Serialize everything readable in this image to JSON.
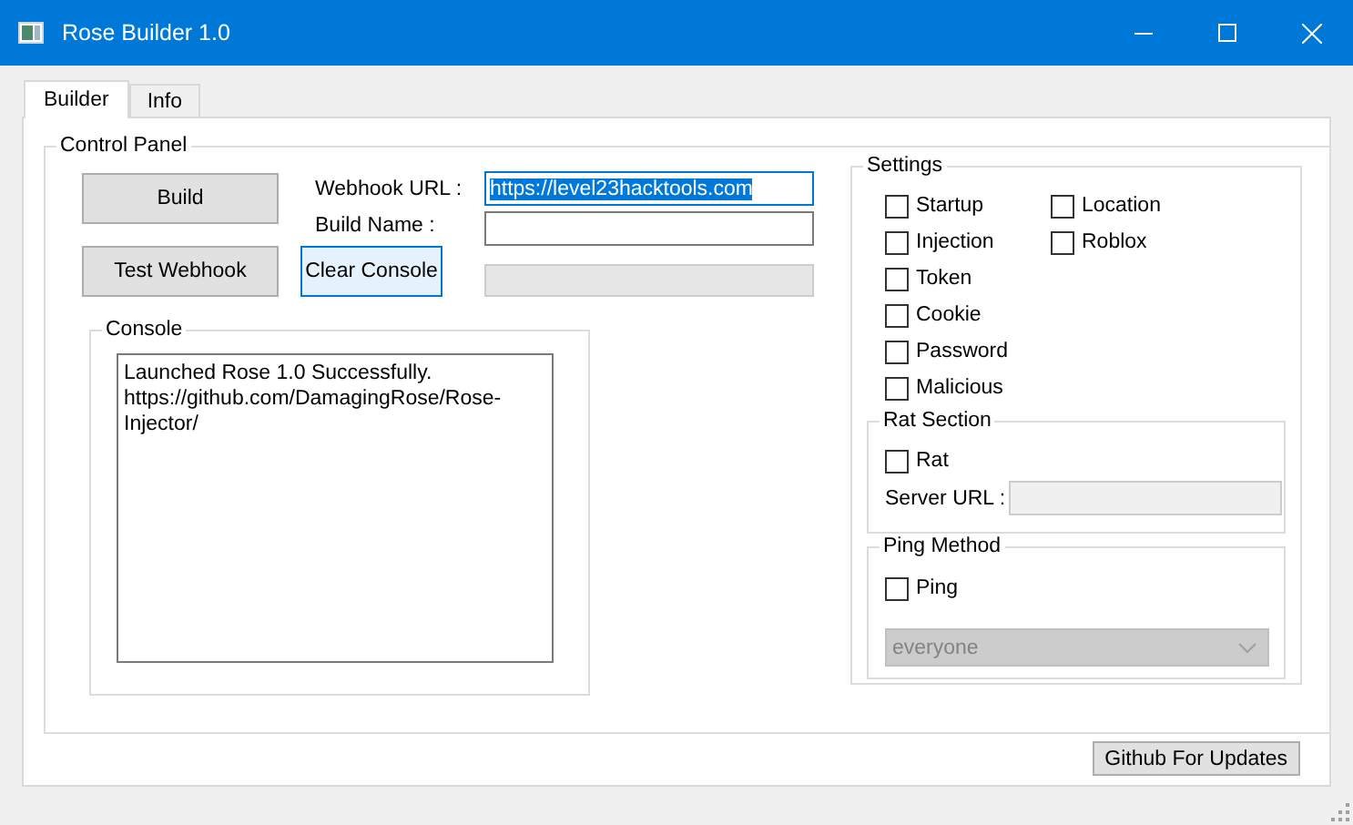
{
  "window": {
    "title": "Rose Builder 1.0"
  },
  "tabs": [
    {
      "label": "Builder",
      "selected": true
    },
    {
      "label": "Info",
      "selected": false
    }
  ],
  "control_panel": {
    "title": "Control Panel",
    "build_button": {
      "label": "Build",
      "focused": false
    },
    "test_webhook_button": {
      "label": "Test Webhook",
      "focused": false
    },
    "clear_console_button": {
      "label": "Clear Console",
      "focused": true
    },
    "webhook_url": {
      "label": "Webhook URL :",
      "value": "https://level23hacktools.com",
      "selected": true
    },
    "build_name": {
      "label": "Build Name :"
    },
    "field_3": {
      "disabled": true
    },
    "console": {
      "title": "Console",
      "lines": [
        "Launched Rose 1.0 Successfully.",
        "https://github.com/DamagingRose/Rose-Injector/"
      ]
    }
  },
  "settings": {
    "title": "Settings",
    "options": [
      {
        "label": "Startup",
        "checked": false
      },
      {
        "label": "Injection",
        "checked": false
      },
      {
        "label": "Token",
        "checked": false
      },
      {
        "label": "Cookie",
        "checked": false
      },
      {
        "label": "Password",
        "checked": false
      },
      {
        "label": "Malicious",
        "checked": false
      },
      {
        "label": "Location",
        "checked": false
      },
      {
        "label": "Roblox",
        "checked": false
      }
    ],
    "rat_section": {
      "title": "Rat Section",
      "rat": {
        "label": "Rat",
        "checked": false
      },
      "server_url": {
        "label": "Server URL :",
        "disabled": true
      }
    },
    "ping_method": {
      "title": "Ping Method",
      "ping": {
        "label": "Ping",
        "checked": false
      },
      "mention": {
        "value": "everyone",
        "disabled": true
      }
    }
  },
  "footer_button": "Github For Updates"
}
